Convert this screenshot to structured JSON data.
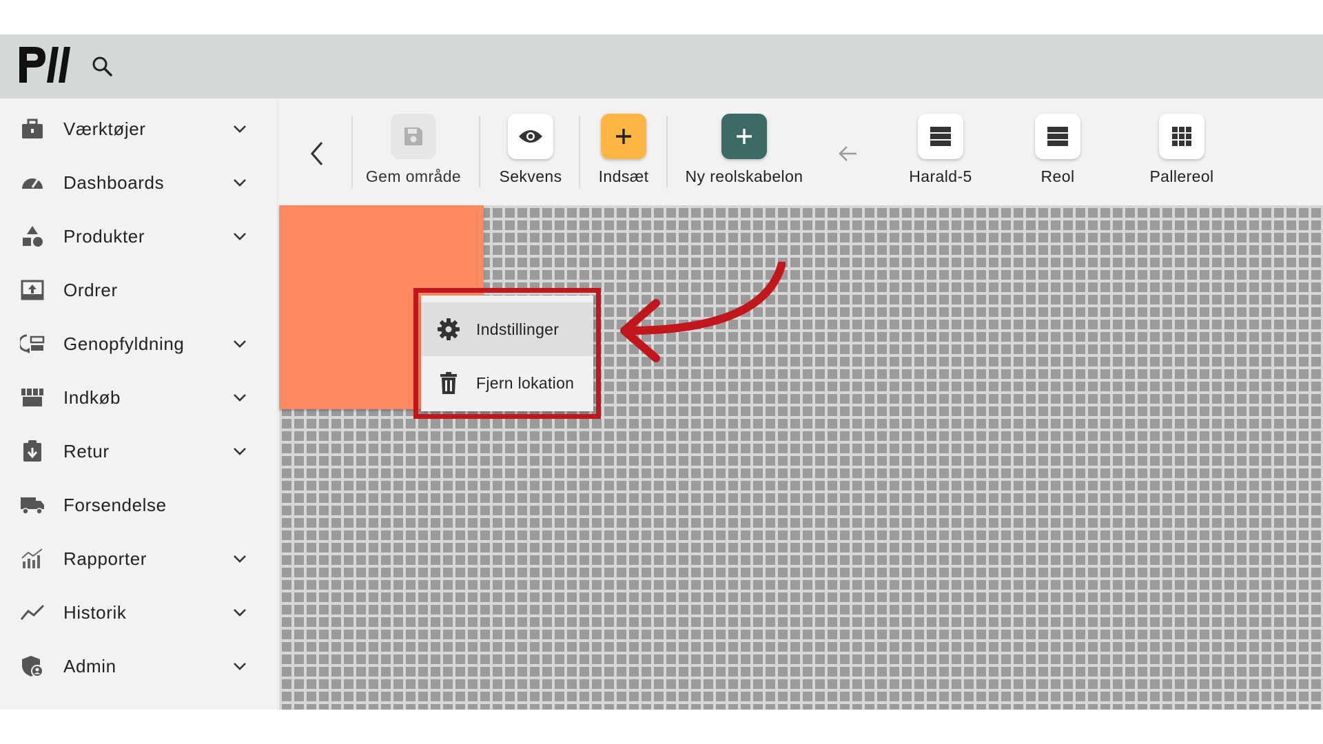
{
  "app": {
    "logo_text": "PW"
  },
  "header": {
    "search_icon": "search-icon"
  },
  "sidebar": {
    "items": [
      {
        "label": "Værktøjer",
        "icon": "toolbox-icon",
        "has_chevron": true
      },
      {
        "label": "Dashboards",
        "icon": "speedometer-icon",
        "has_chevron": true
      },
      {
        "label": "Produkter",
        "icon": "shapes-icon",
        "has_chevron": true
      },
      {
        "label": "Ordrer",
        "icon": "inbox-upload-icon",
        "has_chevron": false
      },
      {
        "label": "Genopfyldning",
        "icon": "replenish-icon",
        "has_chevron": true
      },
      {
        "label": "Indkøb",
        "icon": "store-icon",
        "has_chevron": true
      },
      {
        "label": "Retur",
        "icon": "return-clipboard-icon",
        "has_chevron": true
      },
      {
        "label": "Forsendelse",
        "icon": "truck-icon",
        "has_chevron": false
      },
      {
        "label": "Rapporter",
        "icon": "chart-bars-icon",
        "has_chevron": true
      },
      {
        "label": "Historik",
        "icon": "trend-line-icon",
        "has_chevron": true
      },
      {
        "label": "Admin",
        "icon": "shield-user-icon",
        "has_chevron": true
      }
    ]
  },
  "toolbar": {
    "tools": [
      {
        "label": "Gem område",
        "icon": "save-icon",
        "bg": "#e6e6e6",
        "fg": "#b0b0b0"
      },
      {
        "label": "Sekvens",
        "icon": "eye-icon",
        "bg": "#ffffff",
        "fg": "#333333"
      },
      {
        "label": "Indsæt",
        "icon": "plus-icon",
        "bg": "#fdb544",
        "fg": "#222222"
      },
      {
        "label": "Ny reolskabelon",
        "icon": "plus-icon",
        "bg": "#3d6b63",
        "fg": "#ffffff"
      },
      {
        "label": "Harald-5",
        "icon": "list-lines-icon",
        "bg": "#ffffff",
        "fg": "#333333"
      },
      {
        "label": "Reol",
        "icon": "list-lines-icon",
        "bg": "#ffffff",
        "fg": "#333333"
      },
      {
        "label": "Pallereol",
        "icon": "grid-dots-icon",
        "bg": "#ffffff",
        "fg": "#333333"
      }
    ]
  },
  "context_menu": {
    "items": [
      {
        "label": "Indstillinger",
        "icon": "gear-icon"
      },
      {
        "label": "Fjern lokation",
        "icon": "trash-icon"
      }
    ]
  },
  "colors": {
    "header_bg": "#d2d9d7",
    "shelf_block": "#ff8a62",
    "highlight": "#c0161c"
  }
}
